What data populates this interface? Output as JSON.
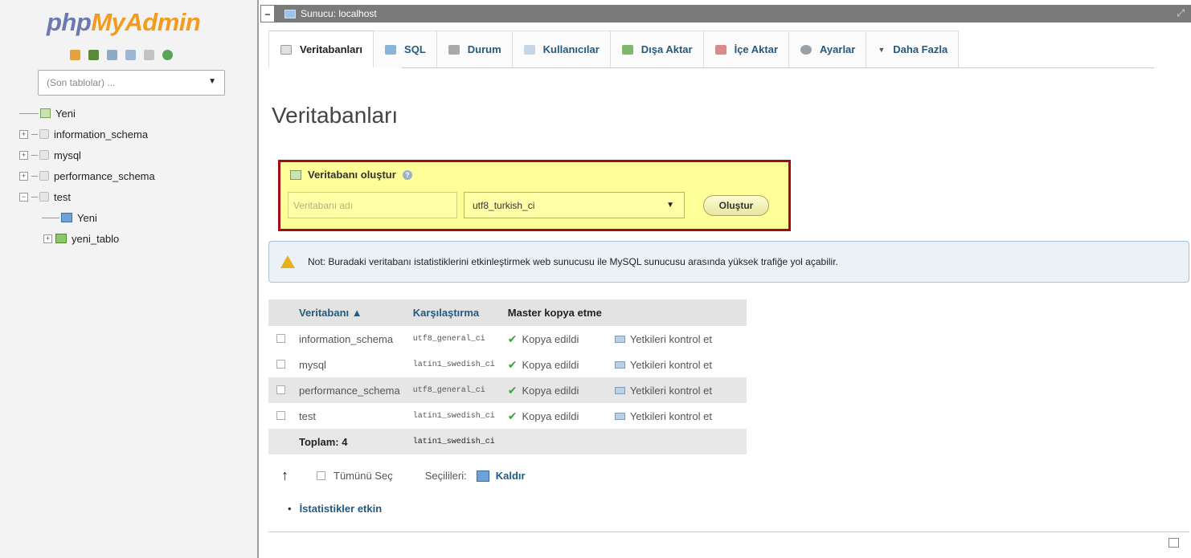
{
  "logo": {
    "part1": "php",
    "part2": "MyAdmin"
  },
  "nav": {
    "icons": [
      "home-icon",
      "logout-icon",
      "query-window-icon",
      "docs-icon",
      "sql-docs-icon",
      "reload-icon"
    ],
    "recent_tables": "(Son tablolar) ...",
    "tree": [
      {
        "label": "Yeni",
        "kind": "new",
        "indent": 0
      },
      {
        "label": "information_schema",
        "kind": "db",
        "indent": 0
      },
      {
        "label": "mysql",
        "kind": "db",
        "indent": 0
      },
      {
        "label": "performance_schema",
        "kind": "db",
        "indent": 0
      },
      {
        "label": "test",
        "kind": "db-open",
        "indent": 0
      },
      {
        "label": "Yeni",
        "kind": "new-table",
        "indent": 1
      },
      {
        "label": "yeni_tablo",
        "kind": "table",
        "indent": 1
      }
    ]
  },
  "server_bar": {
    "title": "Sunucu: localhost"
  },
  "tabs": [
    {
      "label": "Veritabanları",
      "icon": "databases-icon",
      "active": true,
      "color": "#e0e0e0"
    },
    {
      "label": "SQL",
      "icon": "sql-icon",
      "active": false,
      "color": "#8ab4d8"
    },
    {
      "label": "Durum",
      "icon": "status-icon",
      "active": false,
      "color": "#a9a9a9"
    },
    {
      "label": "Kullanıcılar",
      "icon": "users-icon",
      "active": false,
      "color": "#c7d6e6"
    },
    {
      "label": "Dışa Aktar",
      "icon": "export-icon",
      "active": false,
      "color": "#7eb86b"
    },
    {
      "label": "İçe Aktar",
      "icon": "import-icon",
      "active": false,
      "color": "#d98a8a"
    },
    {
      "label": "Ayarlar",
      "icon": "settings-icon",
      "active": false,
      "color": "#9aa0a6"
    },
    {
      "label": "Daha Fazla",
      "icon": "chevron-down-icon",
      "active": false,
      "color": "transparent"
    }
  ],
  "page_title": "Veritabanları",
  "create": {
    "legend": "Veritabanı oluştur",
    "name_placeholder": "Veritabanı adı",
    "collation": "utf8_turkish_ci",
    "button": "Oluştur"
  },
  "notice": "Not: Buradaki veritabanı istatistiklerini etkinleştirmek web sunucusu ile MySQL sunucusu arasında yüksek trafiğe yol açabilir.",
  "table": {
    "headers": {
      "database": "Veritabanı ▲",
      "collation": "Karşılaştırma",
      "replication": "Master kopya etme"
    },
    "rows": [
      {
        "name": "information_schema",
        "collation": "utf8_general_ci",
        "replication": "Kopya edildi",
        "action": "Yetkileri kontrol et"
      },
      {
        "name": "mysql",
        "collation": "latin1_swedish_ci",
        "replication": "Kopya edildi",
        "action": "Yetkileri kontrol et"
      },
      {
        "name": "performance_schema",
        "collation": "utf8_general_ci",
        "replication": "Kopya edildi",
        "action": "Yetkileri kontrol et"
      },
      {
        "name": "test",
        "collation": "latin1_swedish_ci",
        "replication": "Kopya edildi",
        "action": "Yetkileri kontrol et"
      }
    ],
    "total_label": "Toplam: 4",
    "total_collation": "latin1_swedish_ci"
  },
  "bulk": {
    "select_all": "Tümünü Seç",
    "with_selected": "Seçilileri:",
    "drop": "Kaldır"
  },
  "stats_link": "İstatistikler etkin"
}
